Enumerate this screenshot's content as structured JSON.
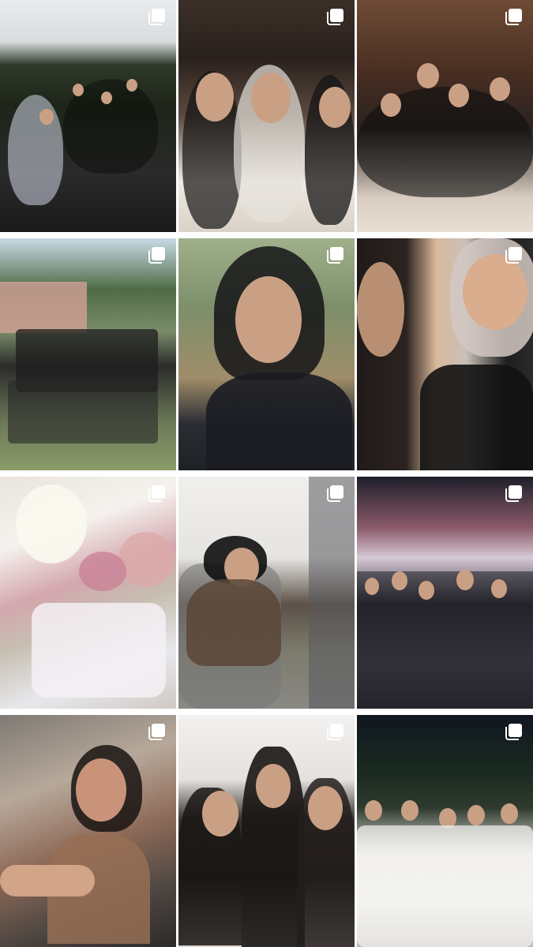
{
  "posts": [
    {
      "id": "post-1",
      "type": "carousel",
      "icon": "multiple-photos-icon"
    },
    {
      "id": "post-2",
      "type": "carousel",
      "icon": "multiple-photos-icon"
    },
    {
      "id": "post-3",
      "type": "carousel",
      "icon": "multiple-photos-icon"
    },
    {
      "id": "post-4",
      "type": "carousel",
      "icon": "multiple-photos-icon"
    },
    {
      "id": "post-5",
      "type": "carousel",
      "icon": "multiple-photos-icon"
    },
    {
      "id": "post-6",
      "type": "carousel",
      "icon": "multiple-photos-icon"
    },
    {
      "id": "post-7",
      "type": "carousel",
      "icon": "multiple-photos-icon"
    },
    {
      "id": "post-8",
      "type": "carousel",
      "icon": "multiple-photos-icon"
    },
    {
      "id": "post-9",
      "type": "carousel",
      "icon": "multiple-photos-icon"
    },
    {
      "id": "post-10",
      "type": "carousel",
      "icon": "multiple-photos-icon"
    },
    {
      "id": "post-11",
      "type": "carousel",
      "icon": "multiple-photos-icon"
    },
    {
      "id": "post-12",
      "type": "carousel",
      "icon": "multiple-photos-icon"
    }
  ],
  "colors": {
    "background": "#ffffff",
    "icon": "#ffffff"
  }
}
